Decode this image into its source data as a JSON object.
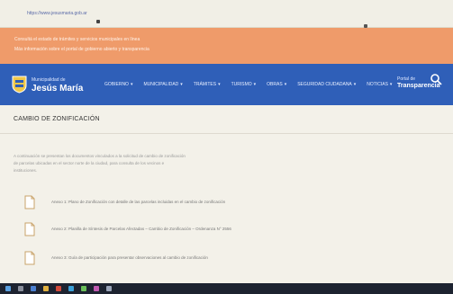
{
  "browser": {
    "url": "https://www.jesusmaria.gob.ar"
  },
  "notice": {
    "line1": "Consultá el estado de trámites y servicios municipales en línea",
    "line2": "Más información sobre el portal de gobierno abierto y transparencia"
  },
  "header": {
    "logo_small": "Municipalidad de",
    "logo_big": "Jesús María",
    "nav": [
      {
        "label": "GOBIERNO"
      },
      {
        "label": "MUNICIPALIDAD"
      },
      {
        "label": "TRÁMITES"
      },
      {
        "label": "TURISMO"
      },
      {
        "label": "OBRAS"
      },
      {
        "label": "SEGURIDAD CIUDADANA"
      },
      {
        "label": "NOTICIAS"
      }
    ],
    "portal_small": "Portal de",
    "portal_big": "Transparencia",
    "search_icon": "search-icon"
  },
  "main": {
    "title": "CAMBIO DE ZONIFICACIÓN",
    "paragraph": [
      "A continuación se presentan los documentos vinculados a la solicitud de cambio de zonificación",
      "de parcelas ubicadas en el sector norte de la ciudad, para consulta de los vecinos e",
      "instituciones."
    ],
    "files": [
      {
        "text": "Anexo 1: Plano de Zonificación con detalle de las parcelas incluidas en el cambio de zonificación"
      },
      {
        "text": "Anexo 2: Planilla de Síntesis de Parcelas Afectadas – Cambio de Zonificación – Ordenanza N° 2556"
      },
      {
        "text": "Anexo 3: Guía de participación para presentar observaciones al cambio de zonificación"
      }
    ]
  },
  "colors": {
    "notice_bg": "#ef9b6a",
    "header_bg": "#2f5fb8",
    "content_bg": "#f3f1e9",
    "taskbar_bg": "#1d2330"
  }
}
